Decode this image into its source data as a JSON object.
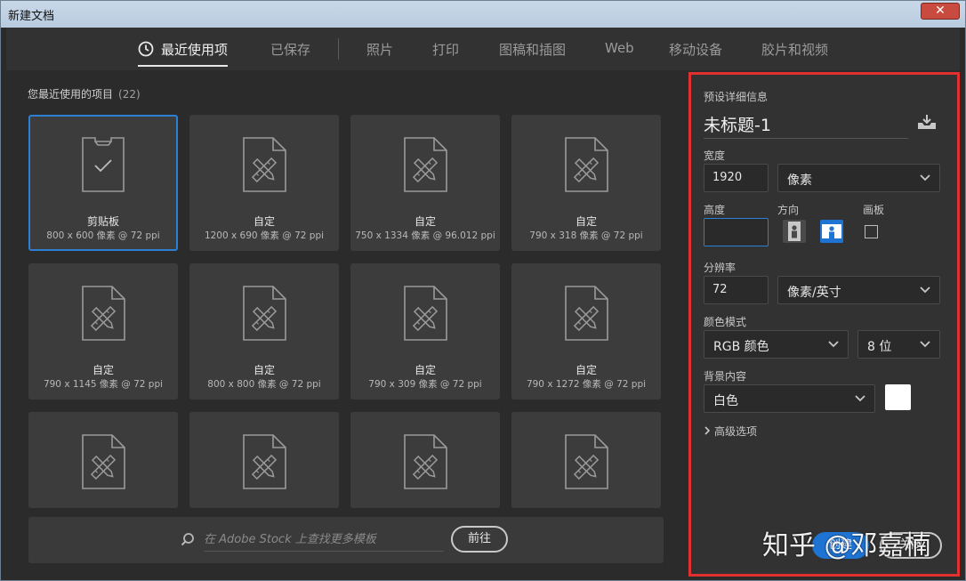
{
  "window": {
    "title": "新建文档",
    "close_label": "✕"
  },
  "tabs": [
    {
      "label": "最近使用项",
      "active": true
    },
    {
      "label": "已保存"
    },
    {
      "label": "照片"
    },
    {
      "label": "打印"
    },
    {
      "label": "图稿和插图"
    },
    {
      "label": "Web"
    },
    {
      "label": "移动设备"
    },
    {
      "label": "胶片和视频"
    }
  ],
  "recent": {
    "title": "您最近使用的项目",
    "count": "(22)",
    "items": [
      {
        "name": "剪贴板",
        "meta": "800 x 600 像素 @ 72 ppi",
        "icon": "clipboard-icon",
        "selected": true
      },
      {
        "name": "自定",
        "meta": "1200 x 690 像素 @ 72 ppi",
        "icon": "document-tools-icon"
      },
      {
        "name": "自定",
        "meta": "750 x 1334 像素 @ 96.012 ppi",
        "icon": "document-tools-icon"
      },
      {
        "name": "自定",
        "meta": "790 x 318 像素 @ 72 ppi",
        "icon": "document-tools-icon"
      },
      {
        "name": "自定",
        "meta": "790 x 1145 像素 @ 72 ppi",
        "icon": "document-tools-icon"
      },
      {
        "name": "自定",
        "meta": "800 x 800 像素 @ 72 ppi",
        "icon": "document-tools-icon"
      },
      {
        "name": "自定",
        "meta": "790 x 309 像素 @ 72 ppi",
        "icon": "document-tools-icon"
      },
      {
        "name": "自定",
        "meta": "790 x 1272 像素 @ 72 ppi",
        "icon": "document-tools-icon"
      },
      {
        "name": "",
        "meta": "",
        "icon": "document-tools-icon"
      },
      {
        "name": "",
        "meta": "",
        "icon": "document-tools-icon"
      },
      {
        "name": "",
        "meta": "",
        "icon": "document-tools-icon"
      },
      {
        "name": "",
        "meta": "",
        "icon": "document-tools-icon"
      }
    ]
  },
  "stock": {
    "placeholder": "在 Adobe Stock 上查找更多模板",
    "go_label": "前往"
  },
  "preset": {
    "section_title": "预设详细信息",
    "doc_name": "未标题-1",
    "width_label": "宽度",
    "width_value": "1920",
    "width_unit": "像素",
    "height_label": "高度",
    "height_value": "",
    "orientation_label": "方向",
    "artboard_label": "画板",
    "resolution_label": "分辨率",
    "resolution_value": "72",
    "resolution_unit": "像素/英寸",
    "color_mode_label": "颜色模式",
    "color_mode_value": "RGB 颜色",
    "bit_depth_value": "8 位",
    "background_label": "背景内容",
    "background_value": "白色",
    "background_swatch": "#ffffff",
    "advanced_label": "高级选项",
    "create_label": "创建",
    "close_label": "关闭"
  },
  "watermark": "知乎 @邓嘉楠",
  "colors": {
    "accent": "#1f73d2",
    "highlight_border": "#e0302f",
    "selected_border": "#2d7fd3"
  }
}
